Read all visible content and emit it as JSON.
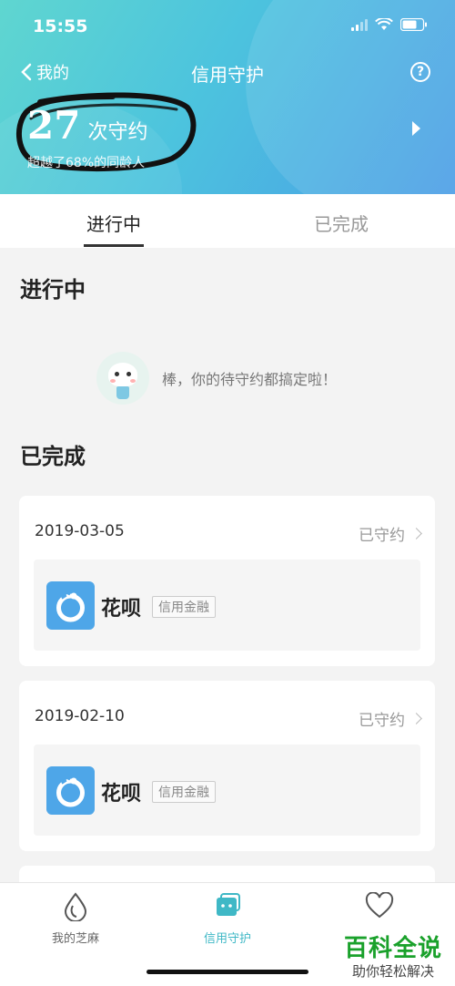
{
  "status_bar": {
    "time": "15:55"
  },
  "header": {
    "back_label": "我的",
    "title": "信用守护",
    "help_symbol": "?",
    "count": "27",
    "count_unit": "次守约",
    "beat_text": "超越了68%的同龄人"
  },
  "tabs": [
    {
      "label": "进行中",
      "active": true
    },
    {
      "label": "已完成",
      "active": false
    }
  ],
  "ongoing": {
    "title": "进行中",
    "empty_message": "棒，你的待守约都搞定啦！"
  },
  "completed": {
    "title": "已完成",
    "records": [
      {
        "date": "2019-03-05",
        "status": "已守约",
        "app": "花呗",
        "tag": "信用金融"
      },
      {
        "date": "2019-02-10",
        "status": "已守约",
        "app": "花呗",
        "tag": "信用金融"
      }
    ]
  },
  "bottom_nav": [
    {
      "label": "我的芝麻",
      "icon": "sesame-drop-icon",
      "active": false
    },
    {
      "label": "信用守护",
      "icon": "shield-card-icon",
      "active": true
    },
    {
      "label": "",
      "icon": "heart-icon",
      "active": false
    }
  ],
  "watermark": {
    "line1": "百科全说",
    "line2": "助你轻松解决"
  },
  "colors": {
    "header_start": "#5fd6d0",
    "header_end": "#4a9de6",
    "accent": "#3fb8c6",
    "app_icon": "#4ea6e8"
  }
}
